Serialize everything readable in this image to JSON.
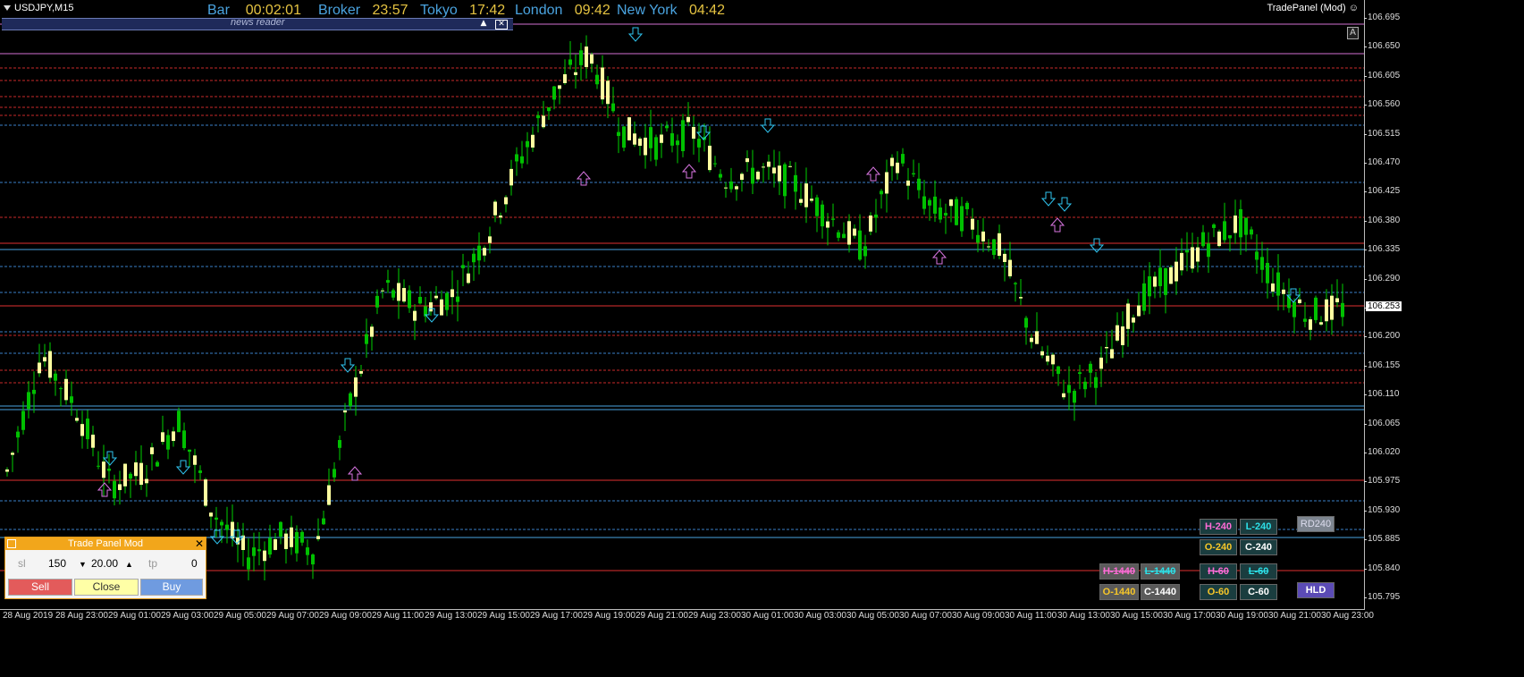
{
  "symbol": "USDJPY,M15",
  "clocks": [
    {
      "label": "Bar",
      "value": "00:02:01"
    },
    {
      "label": "Broker",
      "value": "23:57"
    },
    {
      "label": "Tokyo",
      "value": "17:42"
    },
    {
      "label": "London",
      "value": "09:42"
    },
    {
      "label": "New York",
      "value": "04:42"
    }
  ],
  "news_reader": "news reader",
  "tradepanel_label": "TradePanel (Mod)",
  "a_button": "A",
  "price_ticks": [
    "106.695",
    "106.650",
    "106.605",
    "106.560",
    "106.515",
    "106.470",
    "106.425",
    "106.380",
    "106.335",
    "106.290",
    "106.245",
    "106.200",
    "106.155",
    "106.110",
    "106.065",
    "106.020",
    "105.975",
    "105.930",
    "105.885",
    "105.840",
    "105.795"
  ],
  "current_price": "106.253",
  "time_ticks": [
    "28 Aug 2019",
    "28 Aug 23:00",
    "29 Aug 01:00",
    "29 Aug 03:00",
    "29 Aug 05:00",
    "29 Aug 07:00",
    "29 Aug 09:00",
    "29 Aug 11:00",
    "29 Aug 13:00",
    "29 Aug 15:00",
    "29 Aug 17:00",
    "29 Aug 19:00",
    "29 Aug 21:00",
    "29 Aug 23:00",
    "30 Aug 01:00",
    "30 Aug 03:00",
    "30 Aug 05:00",
    "30 Aug 07:00",
    "30 Aug 09:00",
    "30 Aug 11:00",
    "30 Aug 13:00",
    "30 Aug 15:00",
    "30 Aug 17:00",
    "30 Aug 19:00",
    "30 Aug 21:00",
    "30 Aug 23:00"
  ],
  "trade_panel": {
    "title": "Trade Panel Mod",
    "sl_label": "sl",
    "sl_value": "150",
    "lot_value": "20.00",
    "tp_label": "tp",
    "tp_value": "0",
    "sell": "Sell",
    "close": "Close",
    "buy": "Buy"
  },
  "level_buttons": {
    "h240": "H-240",
    "l240": "L-240",
    "o240": "O-240",
    "c240": "C-240",
    "h1440": "H-1440",
    "l1440": "L-1440",
    "h60": "H-60",
    "l60": "L-60",
    "o1440": "O-1440",
    "c1440": "C-1440",
    "o60": "O-60",
    "c60": "C-60",
    "rd240": "RD240",
    "hld": "HLD"
  },
  "colors": {
    "background": "#000000",
    "bull": "#ffffa0",
    "bear": "#00c000",
    "wick": "#00d000",
    "support_line": "#4aa3df",
    "resistance_line": "#e03030",
    "accent": "#e5c341"
  },
  "chart_data": {
    "type": "candlestick",
    "ylim": [
      105.78,
      106.71
    ],
    "ohlc_sample": [
      [
        105.98,
        106.02,
        105.96,
        106.0
      ],
      [
        106.0,
        106.22,
        105.99,
        106.18
      ],
      [
        106.18,
        106.2,
        106.08,
        106.1
      ],
      [
        106.1,
        106.12,
        105.96,
        105.98
      ],
      [
        105.98,
        106.01,
        105.95,
        106.0
      ],
      [
        106.0,
        106.1,
        105.99,
        106.08
      ],
      [
        106.08,
        106.09,
        105.92,
        105.94
      ],
      [
        105.94,
        105.96,
        105.84,
        105.87
      ],
      [
        105.87,
        105.91,
        105.85,
        105.9
      ],
      [
        105.9,
        105.94,
        105.86,
        105.88
      ],
      [
        105.88,
        106.16,
        105.86,
        106.1
      ],
      [
        106.1,
        106.35,
        106.08,
        106.28
      ],
      [
        106.28,
        106.3,
        106.22,
        106.25
      ],
      [
        106.25,
        106.3,
        106.2,
        106.27
      ],
      [
        106.27,
        106.4,
        106.22,
        106.36
      ],
      [
        106.36,
        106.5,
        106.33,
        106.48
      ],
      [
        106.48,
        106.62,
        106.45,
        106.58
      ],
      [
        106.58,
        106.69,
        106.56,
        106.64
      ],
      [
        106.64,
        106.66,
        106.5,
        106.52
      ],
      [
        106.52,
        106.55,
        106.47,
        106.5
      ],
      [
        106.5,
        106.54,
        106.48,
        106.52
      ],
      [
        106.52,
        106.53,
        106.43,
        106.45
      ],
      [
        106.45,
        106.48,
        106.4,
        106.46
      ],
      [
        106.46,
        106.5,
        106.42,
        106.44
      ],
      [
        106.44,
        106.46,
        106.37,
        106.39
      ],
      [
        106.39,
        106.42,
        106.3,
        106.34
      ],
      [
        106.34,
        106.53,
        106.33,
        106.48
      ],
      [
        106.48,
        106.49,
        106.39,
        106.4
      ],
      [
        106.4,
        106.42,
        106.38,
        106.39
      ],
      [
        106.39,
        106.4,
        106.33,
        106.34
      ],
      [
        106.34,
        106.36,
        106.18,
        106.2
      ],
      [
        106.2,
        106.22,
        106.1,
        106.12
      ],
      [
        106.12,
        106.18,
        106.09,
        106.16
      ],
      [
        106.16,
        106.28,
        106.15,
        106.26
      ],
      [
        106.26,
        106.32,
        106.24,
        106.3
      ],
      [
        106.3,
        106.37,
        106.28,
        106.35
      ],
      [
        106.35,
        106.4,
        106.32,
        106.38
      ],
      [
        106.38,
        106.39,
        106.28,
        106.29
      ],
      [
        106.29,
        106.31,
        106.22,
        106.24
      ],
      [
        106.24,
        106.29,
        106.22,
        106.25
      ]
    ]
  }
}
